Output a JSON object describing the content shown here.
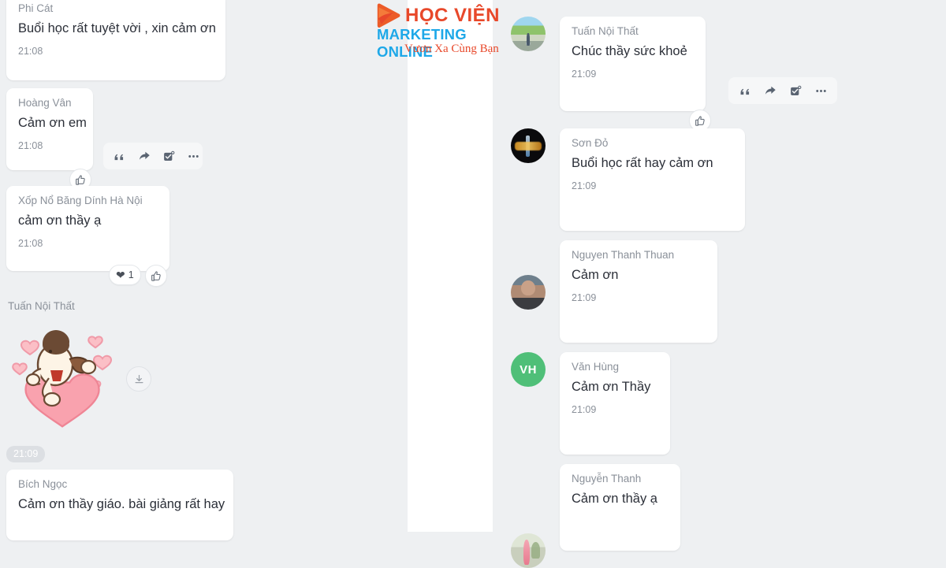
{
  "app": {
    "name": "zalo-group-chat-screenshot",
    "background_color": "#eef0f2",
    "bubble_color": "#ffffff",
    "text_color": "#2b2f38",
    "sender_color": "#8a9099"
  },
  "logo": {
    "line1": "HỌC VIỆN",
    "line2": "MARKETING ONLINE",
    "line3": "Vươn Xa Cùng Bạn",
    "mark": "play-triangle",
    "color_primary": "#e8482a",
    "color_secondary": "#1ea8e8"
  },
  "left_column": {
    "messages": [
      {
        "sender": "Phi Cát",
        "text": "Buổi học rất tuyệt vời , xin cảm ơn",
        "time": "21:08"
      },
      {
        "sender": "Hoàng Vân",
        "text": "Cảm ơn em",
        "time": "21:08"
      },
      {
        "sender": "Xốp Nổ Băng Dính Hà Nội",
        "text": "cảm ơn thầy ạ",
        "time": "21:08"
      },
      {
        "sender": "Bích Ngọc",
        "text": "Cảm ơn thầy giáo. bài giảng rất hay",
        "time": ""
      }
    ],
    "sticker_message": {
      "sender": "Tuấn Nội Thất",
      "sticker": "puppy-with-hearts-sticker",
      "time": "21:09",
      "download_label": "download-icon"
    },
    "toolbar": {
      "quote_label": "quote-icon",
      "forward_label": "forward-icon",
      "select_label": "select-icon",
      "more_label": "more-icon"
    },
    "reactions": {
      "heart_emoji": "❤",
      "heart_count": "1",
      "like_label": "thumbs-up-icon"
    },
    "like_button_label": "thumbs-up-icon"
  },
  "right_column": {
    "messages": [
      {
        "sender": "Tuấn Nội Thất",
        "text": "Chúc thầy sức khoẻ",
        "time": "21:09",
        "avatar_type": "photo-road"
      },
      {
        "sender": "Sơn Đỏ",
        "text": "Buổi học rất hay cảm ơn",
        "time": "21:09",
        "avatar_type": "photo-dark"
      },
      {
        "sender": "Nguyen Thanh Thuan",
        "text": "Cảm ơn",
        "time": "21:09",
        "avatar_type": "photo-man"
      },
      {
        "sender": "Văn Hùng",
        "text": "Cảm ơn Thầy",
        "time": "21:09",
        "avatar_type": "initials",
        "avatar_initials": "VH",
        "avatar_color": "#4fbf78"
      },
      {
        "sender": "Nguyễn Thanh",
        "text": "Cảm  ơn thầy ạ",
        "time": "",
        "avatar_type": "photo-wedding"
      }
    ],
    "toolbar": {
      "quote_label": "quote-icon",
      "forward_label": "forward-icon",
      "select_label": "select-icon",
      "more_label": "more-icon"
    },
    "like_button_label": "thumbs-up-icon"
  }
}
